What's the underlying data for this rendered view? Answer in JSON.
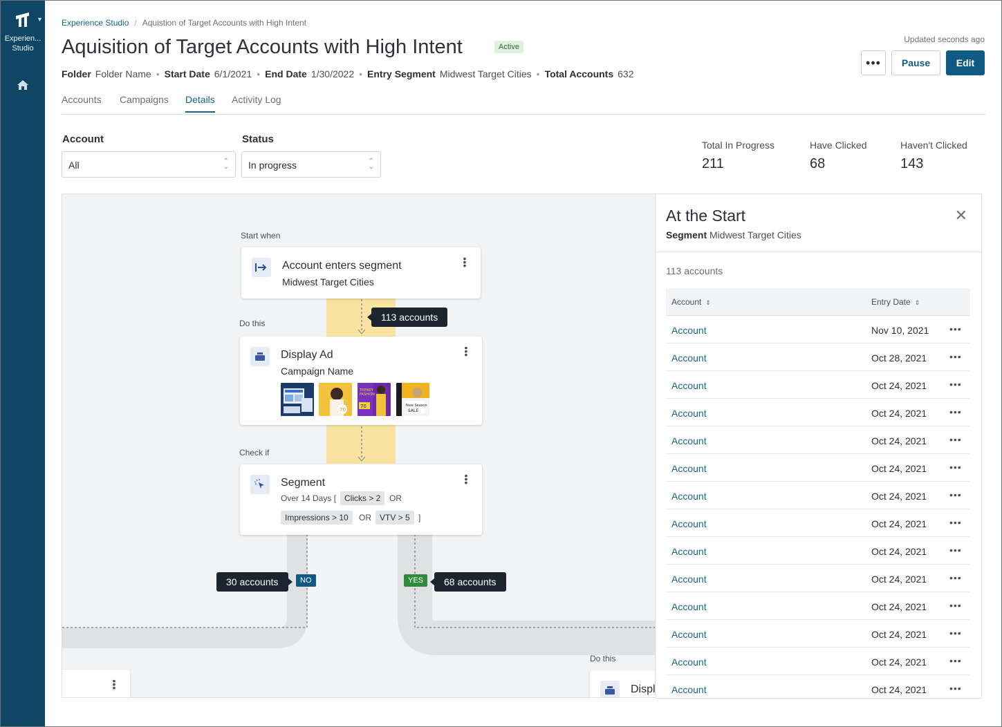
{
  "rail": {
    "app_label": "Experien... Studio",
    "logo_icon": "brand-logo-icon",
    "home_icon": "home-icon"
  },
  "breadcrumb": {
    "root": "Experience Studio",
    "current": "Aquistion of Target Accounts with High Intent"
  },
  "header": {
    "title": "Aquisition of Target Accounts with High Intent",
    "status_badge": "Active",
    "updated": "Updated seconds ago",
    "more_label": "•••",
    "pause_label": "Pause",
    "edit_label": "Edit"
  },
  "meta": {
    "folder_label": "Folder",
    "folder_value": "Folder Name",
    "start_label": "Start Date",
    "start_value": "6/1/2021",
    "end_label": "End Date",
    "end_value": "1/30/2022",
    "segment_label": "Entry Segment",
    "segment_value": "Midwest Target Cities",
    "total_label": "Total Accounts",
    "total_value": "632"
  },
  "tabs": [
    {
      "label": "Accounts"
    },
    {
      "label": "Campaigns"
    },
    {
      "label": "Details"
    },
    {
      "label": "Activity Log"
    }
  ],
  "filters": {
    "account_label": "Account",
    "account_value": "All",
    "status_label": "Status",
    "status_value": "In progress"
  },
  "stats": [
    {
      "label": "Total In Progress",
      "value": "211"
    },
    {
      "label": "Have Clicked",
      "value": "68"
    },
    {
      "label": "Haven't Clicked",
      "value": "143"
    }
  ],
  "flow": {
    "start_label": "Start when",
    "start_title": "Account enters segment",
    "start_sub": "Midwest Target Cities",
    "tip_113": "113 accounts",
    "do_label": "Do this",
    "ad_title": "Display Ad",
    "ad_sub": "Campaign Name",
    "check_label": "Check if",
    "seg_title": "Segment",
    "seg_over": "Over 14 Days [",
    "chip_clicks": "Clicks > 2",
    "or": "OR",
    "chip_impr": "Impressions > 10",
    "chip_vtv": "VTV > 5",
    "close_bracket": "]",
    "no_tag": "NO",
    "no_tip": "30 accounts",
    "yes_tag": "YES",
    "yes_tip": "68 accounts",
    "do_label_2": "Do this",
    "partial_title": "Displ",
    "colors": {
      "highlight": "#f8e3a1",
      "no": "#0f5a85",
      "yes": "#2e8b3a"
    }
  },
  "panel": {
    "title": "At the Start",
    "segment_label": "Segment",
    "segment_value": "Midwest Target Cities",
    "count": "113 accounts",
    "col_account": "Account",
    "col_date": "Entry Date",
    "rows": [
      {
        "account": "Account",
        "date": "Nov 10, 2021"
      },
      {
        "account": "Account",
        "date": "Oct 28, 2021"
      },
      {
        "account": "Account",
        "date": "Oct 24, 2021"
      },
      {
        "account": "Account",
        "date": "Oct 24, 2021"
      },
      {
        "account": "Account",
        "date": "Oct 24, 2021"
      },
      {
        "account": "Account",
        "date": "Oct 24, 2021"
      },
      {
        "account": "Account",
        "date": "Oct 24, 2021"
      },
      {
        "account": "Account",
        "date": "Oct 24, 2021"
      },
      {
        "account": "Account",
        "date": "Oct 24, 2021"
      },
      {
        "account": "Account",
        "date": "Oct 24, 2021"
      },
      {
        "account": "Account",
        "date": "Oct 24, 2021"
      },
      {
        "account": "Account",
        "date": "Oct 24, 2021"
      },
      {
        "account": "Account",
        "date": "Oct 24, 2021"
      },
      {
        "account": "Account",
        "date": "Oct 24, 2021"
      }
    ]
  }
}
